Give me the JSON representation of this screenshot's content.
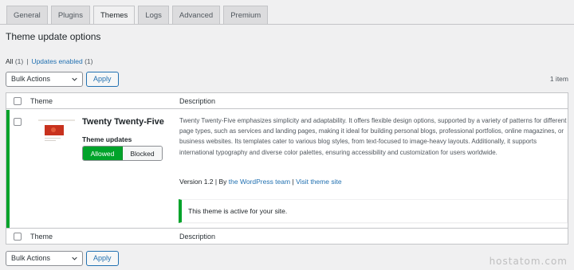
{
  "tabs": [
    {
      "label": "General"
    },
    {
      "label": "Plugins"
    },
    {
      "label": "Themes",
      "active": true
    },
    {
      "label": "Logs"
    },
    {
      "label": "Advanced"
    },
    {
      "label": "Premium"
    }
  ],
  "page_title": "Theme update options",
  "filters": {
    "all_label": "All",
    "all_count": "(1)",
    "separator": "|",
    "updates_label": "Updates enabled",
    "updates_count": "(1)"
  },
  "bulk": {
    "select_value": "Bulk Actions",
    "apply_label": "Apply",
    "item_count": "1 item"
  },
  "table": {
    "col_theme": "Theme",
    "col_description": "Description"
  },
  "theme": {
    "name": "Twenty Twenty-Five",
    "updates_label": "Theme updates",
    "allowed_label": "Allowed",
    "blocked_label": "Blocked",
    "description": "Twenty Twenty-Five emphasizes simplicity and adaptability. It offers flexible design options, supported by a variety of patterns for different page types, such as services and landing pages, making it ideal for building personal blogs, professional portfolios, online magazines, or business websites. Its templates cater to various blog styles, from text-focused to image-heavy layouts. Additionally, it supports international typography and diverse color palettes, ensuring accessibility and customization for users worldwide.",
    "version_text": "Version 1.2 | By",
    "author_link": "the WordPress team",
    "meta_sep": "|",
    "visit_link": "Visit theme site",
    "notice": "This theme is active for your site."
  },
  "watermark": "hostatom.com",
  "colors": {
    "active_green": "#00a32a",
    "link_blue": "#2271b1",
    "background": "#f0f0f1"
  }
}
